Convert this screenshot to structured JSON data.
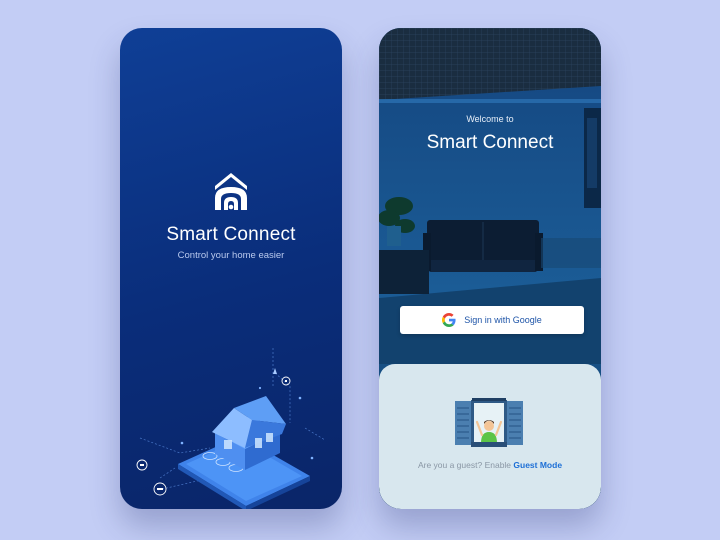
{
  "splash": {
    "app_name": "Smart Connect",
    "tagline": "Control your home easier",
    "logo_icon": "home-wifi-logo",
    "illustration": "isometric-smart-home-on-phone"
  },
  "welcome": {
    "greeting": "Welcome to",
    "app_name": "Smart Connect",
    "background": "dark-living-room-photo",
    "google_button": {
      "label": "Sign in with Google",
      "icon": "google-g-icon"
    },
    "guest": {
      "prompt": "Are you a guest? Enable ",
      "link": "Guest Mode",
      "illustration": "person-waving-at-window"
    }
  },
  "colors": {
    "page_background": "#c3cdf5",
    "splash_gradient_top": "#0f3f96",
    "splash_gradient_bottom": "#0a2568",
    "accent_link": "#1d6fd6",
    "guest_panel": "#d8e7ee"
  }
}
